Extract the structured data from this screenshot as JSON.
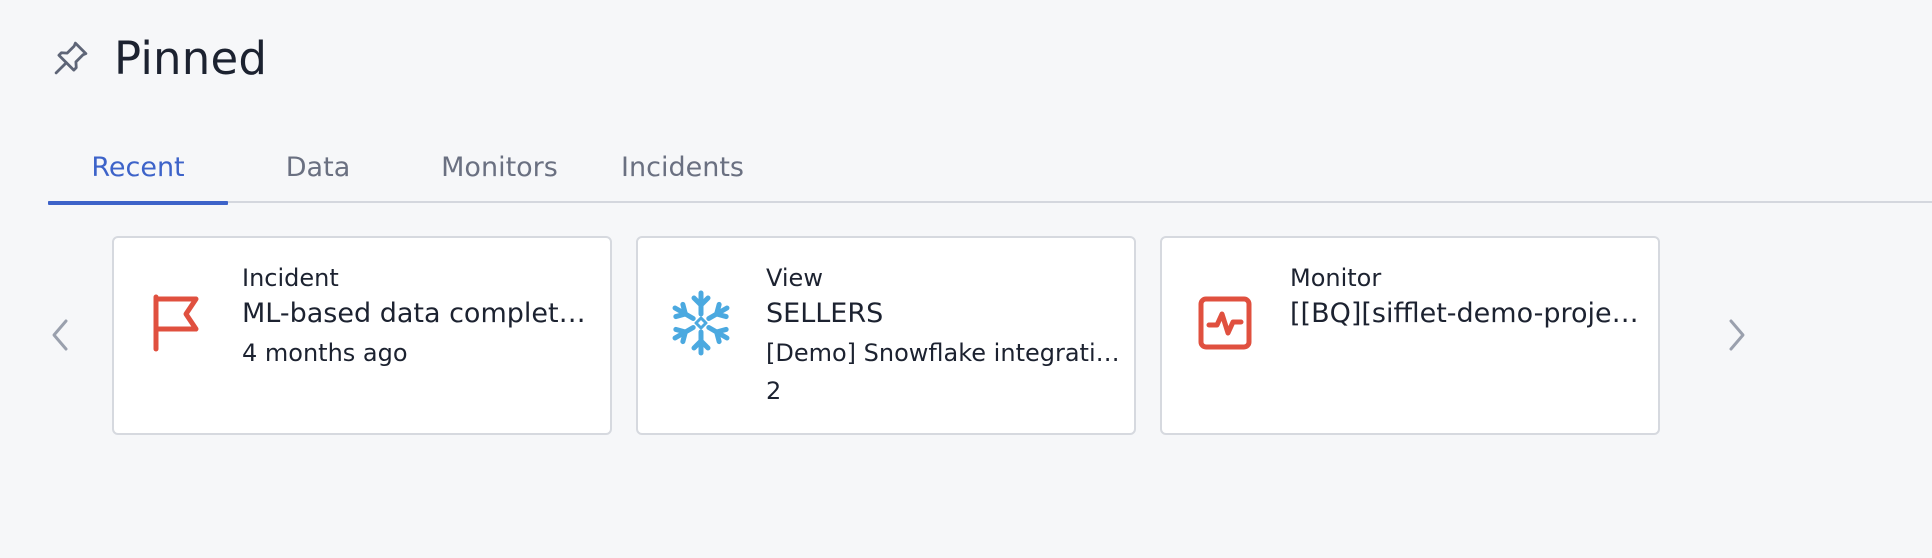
{
  "header": {
    "title": "Pinned",
    "icon": "pin-icon"
  },
  "tabs": [
    {
      "label": "Recent",
      "active": true
    },
    {
      "label": "Data",
      "active": false
    },
    {
      "label": "Monitors",
      "active": false
    },
    {
      "label": "Incidents",
      "active": false
    }
  ],
  "carousel": {
    "prev_icon": "chevron-left-icon",
    "next_icon": "chevron-right-icon",
    "cards": [
      {
        "type": "Incident",
        "title": "ML-based data completeness",
        "line1": "4 months ago",
        "line2": "",
        "icon": "flag-icon",
        "icon_color": "#e0503f"
      },
      {
        "type": "View",
        "title": "SELLERS",
        "line1": "[Demo] Snowflake integration",
        "line2": "2",
        "icon": "snowflake-icon",
        "icon_color": "#4ba9e0"
      },
      {
        "type": "Monitor",
        "title": "[[BQ][sifflet-demo-project]]",
        "line1": "",
        "line2": "",
        "icon": "monitor-pulse-icon",
        "icon_color": "#e0503f"
      }
    ]
  },
  "colors": {
    "accent": "#3d63c9",
    "incident": "#e0503f",
    "snowflake": "#4ba9e0",
    "background": "#f6f7f9"
  }
}
